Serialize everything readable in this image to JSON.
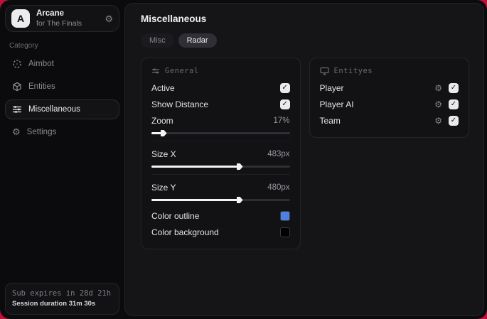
{
  "app": {
    "logo_letter": "A",
    "name": "Arcane",
    "subtitle": "for The Finals"
  },
  "icons": {
    "gear": "⚙",
    "check": "✓",
    "dots": "······"
  },
  "sidebar": {
    "category_label": "Category",
    "items": [
      {
        "label": "Aimbot",
        "icon": "crosshair-icon",
        "active": false
      },
      {
        "label": "Entities",
        "icon": "cube-icon",
        "active": false
      },
      {
        "label": "Miscellaneous",
        "icon": "sliders-icon",
        "active": true
      },
      {
        "label": "Settings",
        "icon": "gear-icon",
        "active": false
      }
    ],
    "footer": {
      "sub_line": "Sub expires in 28d 21h",
      "session_line": "Session duration 31m 30s"
    }
  },
  "main": {
    "title": "Miscellaneous",
    "tabs": [
      {
        "label": "Misc",
        "active": false
      },
      {
        "label": "Radar",
        "active": true
      }
    ],
    "general_panel": {
      "title": "General",
      "active": {
        "label": "Active",
        "checked": true
      },
      "show_distance": {
        "label": "Show Distance",
        "checked": true
      },
      "zoom": {
        "label": "Zoom",
        "value": "17%",
        "fill_percent": 7
      },
      "size_x": {
        "label": "Size X",
        "value": "483px",
        "fill_percent": 62
      },
      "size_y": {
        "label": "Size Y",
        "value": "480px",
        "fill_percent": 62
      },
      "color_outline": {
        "label": "Color outline",
        "color": "#4d80e4"
      },
      "color_background": {
        "label": "Color background",
        "color": "#000000"
      }
    },
    "entities_panel": {
      "title": "Entityes",
      "rows": [
        {
          "label": "Player",
          "checked": true
        },
        {
          "label": "Player AI",
          "checked": true
        },
        {
          "label": "Team",
          "checked": true
        }
      ]
    }
  },
  "colors": {
    "accent_red": "#c3103a",
    "outline_swatch": "#4d80e4",
    "background_swatch": "#000000"
  }
}
